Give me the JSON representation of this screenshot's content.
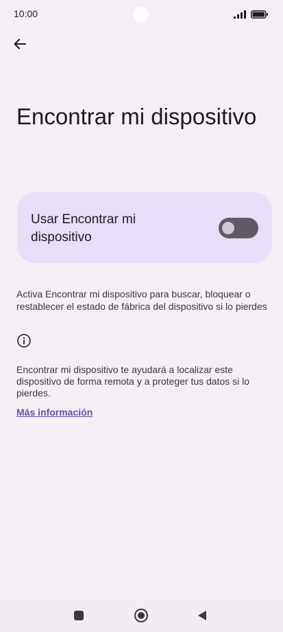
{
  "status_bar": {
    "time": "10:00"
  },
  "header": {
    "back_icon": "arrow-back-icon",
    "title": "Encontrar mi dispositivo"
  },
  "toggle": {
    "label": "Usar Encontrar mi dispositivo",
    "enabled": false
  },
  "description": "Activa Encontrar mi dispositivo para buscar, bloquear o restablecer el estado de fábrica del dispositivo si lo pierdes",
  "info": {
    "icon": "info-icon",
    "text": "Encontrar mi dispositivo te ayudará a localizar este dispositivo de forma remota y a proteger tus datos si lo pierdes.",
    "link_label": "Más información"
  },
  "nav_bar": {
    "recents_icon": "square-icon",
    "home_icon": "circle-icon",
    "back_icon": "triangle-back-icon"
  },
  "colors": {
    "background": "#f4eff4",
    "card": "#e8def8",
    "switch_track_off": "#5f5b66",
    "link": "#6750a4"
  }
}
